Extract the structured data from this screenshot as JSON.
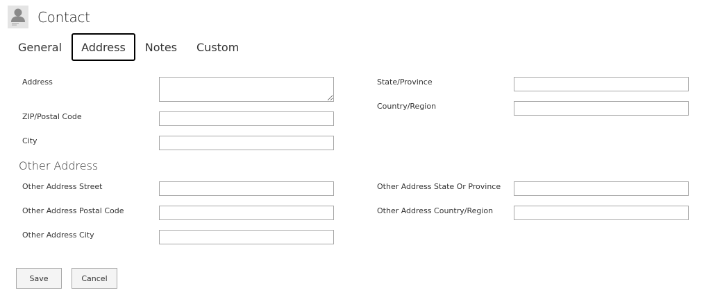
{
  "header": {
    "title": "Contact",
    "avatar_icon": "person-icon"
  },
  "tabs": [
    {
      "label": "General"
    },
    {
      "label": "Address",
      "active": true
    },
    {
      "label": "Notes"
    },
    {
      "label": "Custom"
    }
  ],
  "address": {
    "address_label": "Address",
    "address_value": "",
    "zip_label": "ZIP/Postal Code",
    "zip_value": "",
    "city_label": "City",
    "city_value": "",
    "state_label": "State/Province",
    "state_value": "",
    "country_label": "Country/Region",
    "country_value": ""
  },
  "other_address": {
    "heading": "Other Address",
    "street_label": "Other Address Street",
    "street_value": "",
    "postal_label": "Other Address Postal Code",
    "postal_value": "",
    "city_label": "Other Address City",
    "city_value": "",
    "state_label": "Other Address State Or Province",
    "state_value": "",
    "country_label": "Other Address Country/Region",
    "country_value": ""
  },
  "actions": {
    "save_label": "Save",
    "cancel_label": "Cancel"
  },
  "colors": {
    "input_border": "#a6a6a6",
    "button_bg": "#f4f4f4",
    "active_tab_border": "#000000",
    "text": "#333333"
  }
}
